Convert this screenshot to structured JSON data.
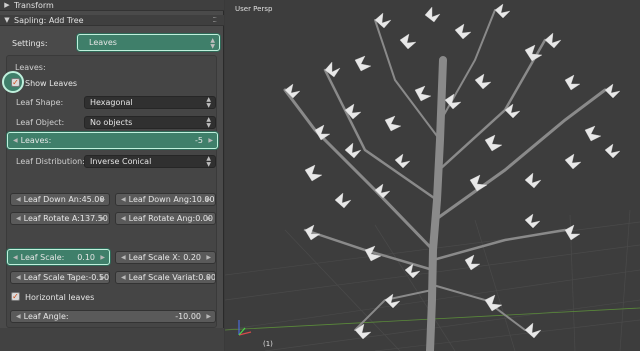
{
  "panel": {
    "transform_header": "Transform",
    "sapling_header": "Sapling: Add Tree",
    "settings_label": "Settings:",
    "settings_value": "Leaves",
    "leaves_section_label": "Leaves:",
    "show_leaves_label": "Show Leaves",
    "show_leaves_checked": true,
    "leaf_shape_label": "Leaf Shape:",
    "leaf_shape_value": "Hexagonal",
    "leaf_object_label": "Leaf Object:",
    "leaf_object_value": "No objects",
    "leaves_count_label": "Leaves:",
    "leaves_count_value": "-5",
    "leaf_distribution_label": "Leaf Distribution:",
    "leaf_distribution_value": "Inverse Conical",
    "leaf_down_angle_label": "Leaf Down An:",
    "leaf_down_angle_value": "45.00",
    "leaf_down_angle_var_label": "Leaf Down Ang:",
    "leaf_down_angle_var_value": "10.00",
    "leaf_rotate_label": "Leaf Rotate A:",
    "leaf_rotate_value": "137.50",
    "leaf_rotate_var_label": "Leaf Rotate Ang:",
    "leaf_rotate_var_value": "0.00",
    "leaf_scale_label": "Leaf Scale:",
    "leaf_scale_value": "0.10",
    "leaf_scale_x_label": "Leaf Scale X:",
    "leaf_scale_x_value": "0.20",
    "leaf_scale_taper_label": "Leaf Scale Tape:",
    "leaf_scale_taper_value": "-0.50",
    "leaf_scale_variation_label": "Leaf Scale Variat:",
    "leaf_scale_variation_value": "0.00",
    "horizontal_leaves_label": "Horizontal leaves",
    "horizontal_leaves_checked": true,
    "leaf_angle_label": "Leaf Angle:",
    "leaf_angle_value": "-10.00"
  },
  "viewport": {
    "view_label": "User Persp",
    "frame_label": "(1)"
  },
  "colors": {
    "highlight_teal": "#3f7f6a",
    "highlight_border": "#bff0dc",
    "panel_bg": "#4a4a4a",
    "viewport_bg": "#3d3d3d",
    "check_orange": "#d24a14"
  }
}
